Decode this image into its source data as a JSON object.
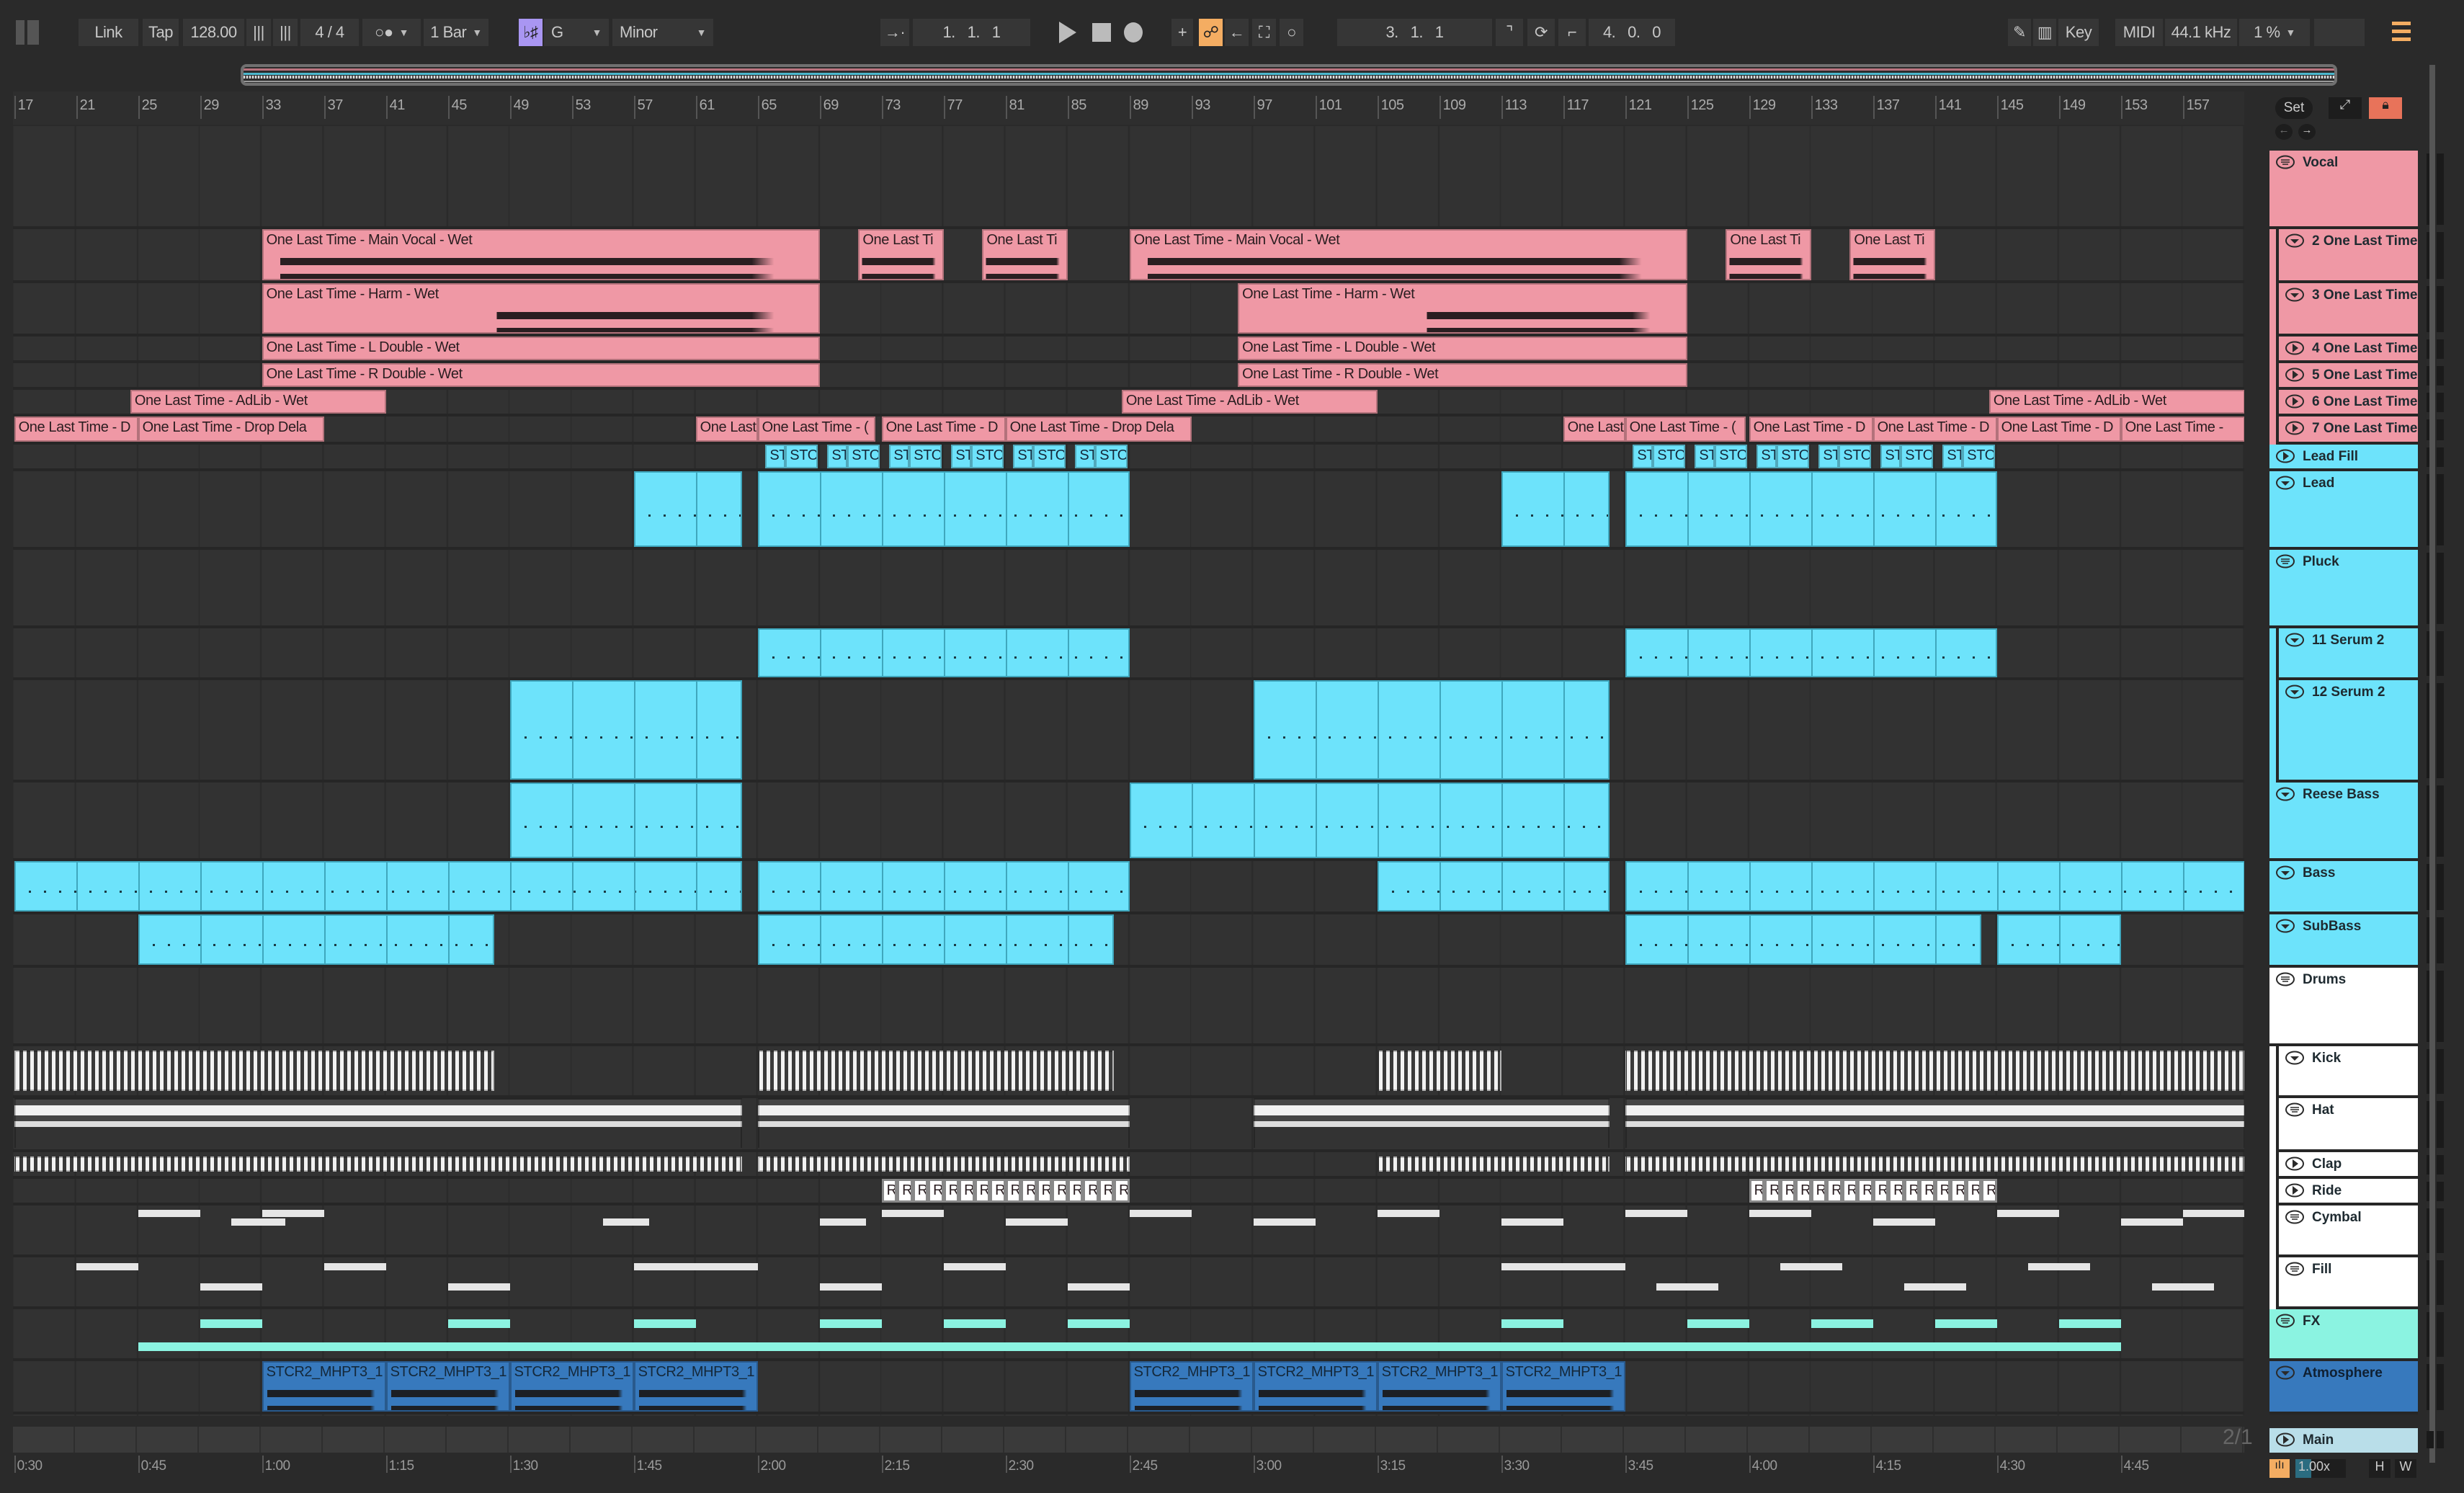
{
  "toolbar": {
    "link": "Link",
    "tap": "Tap",
    "tempo": "128.00",
    "time_signature": "4 / 4",
    "quantize": "1 Bar",
    "scale_toggle": "♭♯",
    "key_root": "G",
    "scale_mode": "Minor",
    "position": "1.   1.   1",
    "loop_start": "3.   1.   1",
    "loop_length": "4.   0.   0",
    "key_map": "Key",
    "midi_map": "MIDI",
    "sample_rate": "44.1 kHz",
    "cpu": "1 %",
    "accent": "#f4ad62",
    "scale_color": "#a996f2"
  },
  "ruler": {
    "bars": [
      17,
      21,
      25,
      29,
      33,
      37,
      41,
      45,
      49,
      53,
      57,
      61,
      65,
      69,
      73,
      77,
      81,
      85,
      89,
      93,
      97,
      101,
      105,
      109,
      113,
      117,
      121,
      125,
      129,
      133,
      137,
      141,
      145,
      149,
      153,
      157
    ],
    "set_button": "Set"
  },
  "timeline": {
    "labels": [
      "0:30",
      "0:45",
      "1:00",
      "1:15",
      "1:30",
      "1:45",
      "2:00",
      "2:15",
      "2:30",
      "2:45",
      "3:00",
      "3:15",
      "3:30",
      "3:45",
      "4:00",
      "4:15",
      "4:30",
      "4:45"
    ]
  },
  "colors": {
    "vocal": "#ef98a5",
    "synth": "#6de3fb",
    "drums": "#ffffff",
    "fx": "#8bf3e1",
    "atmo": "#3779bd",
    "main": "#b9dee9"
  },
  "tracks": [
    {
      "name": "Vocal",
      "icon": "group",
      "color": "vocal",
      "kind": "grp",
      "clips": []
    },
    {
      "name": "2 One Last Time",
      "icon": "expanded",
      "color": "vocal",
      "kind": "audio",
      "child": true,
      "clips": [
        {
          "name": "One Last Time - Main Vocal - Wet",
          "start": 33,
          "end": 69
        },
        {
          "name": "One Last Ti",
          "start": 71.5,
          "end": 77
        },
        {
          "name": "One Last Ti",
          "start": 79.5,
          "end": 85
        },
        {
          "name": "One Last Time - Main Vocal - Wet",
          "start": 89,
          "end": 125
        },
        {
          "name": "One Last Ti",
          "start": 127.5,
          "end": 133
        },
        {
          "name": "One Last Ti",
          "start": 135.5,
          "end": 141
        }
      ]
    },
    {
      "name": "3 One Last Time",
      "icon": "expanded",
      "color": "vocal",
      "kind": "audio",
      "child": true,
      "clips": [
        {
          "name": "One Last Time - Harm - Wet",
          "start": 33,
          "end": 69
        },
        {
          "name": "One Last Time - Harm - Wet",
          "start": 96,
          "end": 125
        }
      ]
    },
    {
      "name": "4 One Last Time",
      "icon": "collapsed",
      "color": "vocal",
      "kind": "label",
      "child": true,
      "clips": [
        {
          "name": "One Last Time - L Double - Wet",
          "start": 33,
          "end": 69
        },
        {
          "name": "One Last Time - L Double - Wet",
          "start": 96,
          "end": 125
        }
      ]
    },
    {
      "name": "5 One Last Time",
      "icon": "collapsed",
      "color": "vocal",
      "kind": "label",
      "child": true,
      "clips": [
        {
          "name": "One Last Time - R Double - Wet",
          "start": 33,
          "end": 69
        },
        {
          "name": "One Last Time - R Double - Wet",
          "start": 96,
          "end": 125
        }
      ]
    },
    {
      "name": "6 One Last Time",
      "icon": "collapsed",
      "color": "vocal",
      "kind": "label",
      "child": true,
      "clips": [
        {
          "name": "One Last Time - AdLib - Wet",
          "start": 24.5,
          "end": 41
        },
        {
          "name": "One Last Time - AdLib - Wet",
          "start": 88.5,
          "end": 105
        },
        {
          "name": "One Last Time - AdLib - Wet",
          "start": 144.5,
          "end": 161
        }
      ]
    },
    {
      "name": "7 One Last Time",
      "icon": "collapsed",
      "color": "vocal",
      "kind": "label",
      "child": true,
      "clips": [
        {
          "name": "One Last Time - D",
          "start": 17,
          "end": 25
        },
        {
          "name": "One Last Time - Drop Dela",
          "start": 25,
          "end": 37
        },
        {
          "name": "One Last",
          "start": 61,
          "end": 65
        },
        {
          "name": "One Last Time - (",
          "start": 65,
          "end": 72.6
        },
        {
          "name": "One Last Time - D",
          "start": 73,
          "end": 81
        },
        {
          "name": "One Last Time - Drop Dela",
          "start": 81,
          "end": 93
        },
        {
          "name": "One Last",
          "start": 117,
          "end": 121
        },
        {
          "name": "One Last Time - (",
          "start": 121,
          "end": 128.8
        },
        {
          "name": "One Last Time - D",
          "start": 129,
          "end": 137
        },
        {
          "name": "One Last Time - D",
          "start": 137,
          "end": 145
        },
        {
          "name": "One Last Time - D",
          "start": 145,
          "end": 153
        },
        {
          "name": "One Last Time -",
          "start": 153,
          "end": 161
        }
      ]
    },
    {
      "name": "Lead Fill",
      "icon": "collapsed",
      "color": "synth",
      "kind": "label",
      "clips": [
        {
          "name": "ST",
          "start": 65.5,
          "end": 66.8
        },
        {
          "name": "STO",
          "start": 66.8,
          "end": 68.9
        },
        {
          "name": "ST",
          "start": 69.5,
          "end": 70.8
        },
        {
          "name": "STO",
          "start": 70.8,
          "end": 72.9
        },
        {
          "name": "ST",
          "start": 73.5,
          "end": 74.8
        },
        {
          "name": "STO",
          "start": 74.8,
          "end": 76.9
        },
        {
          "name": "ST",
          "start": 77.5,
          "end": 78.8
        },
        {
          "name": "STO",
          "start": 78.8,
          "end": 80.9
        },
        {
          "name": "ST",
          "start": 81.5,
          "end": 82.8
        },
        {
          "name": "STO",
          "start": 82.8,
          "end": 84.9
        },
        {
          "name": "ST",
          "start": 85.5,
          "end": 86.8
        },
        {
          "name": "STO",
          "start": 86.8,
          "end": 88.9
        },
        {
          "name": "ST",
          "start": 121.5,
          "end": 122.8
        },
        {
          "name": "STO",
          "start": 122.8,
          "end": 124.9
        },
        {
          "name": "ST",
          "start": 125.5,
          "end": 126.8
        },
        {
          "name": "STO",
          "start": 126.8,
          "end": 128.9
        },
        {
          "name": "ST",
          "start": 129.5,
          "end": 130.8
        },
        {
          "name": "STO",
          "start": 130.8,
          "end": 132.9
        },
        {
          "name": "ST",
          "start": 133.5,
          "end": 134.8
        },
        {
          "name": "STO",
          "start": 134.8,
          "end": 136.9
        },
        {
          "name": "ST",
          "start": 137.5,
          "end": 138.8
        },
        {
          "name": "STO",
          "start": 138.8,
          "end": 140.9
        },
        {
          "name": "ST",
          "start": 141.5,
          "end": 142.8
        },
        {
          "name": "STO",
          "start": 142.8,
          "end": 144.9
        }
      ]
    },
    {
      "name": "Lead",
      "icon": "expanded",
      "color": "synth",
      "kind": "midi",
      "clips": [
        {
          "start": 57,
          "end": 64
        },
        {
          "start": 65,
          "end": 89
        },
        {
          "start": 113,
          "end": 120
        },
        {
          "start": 121,
          "end": 145
        }
      ]
    },
    {
      "name": "Pluck",
      "icon": "group",
      "color": "synth",
      "kind": "grp",
      "clips": []
    },
    {
      "name": "11 Serum 2",
      "icon": "expanded",
      "color": "synth",
      "kind": "midi",
      "child": true,
      "clips": [
        {
          "start": 65,
          "end": 89
        },
        {
          "start": 121,
          "end": 145
        }
      ]
    },
    {
      "name": "12 Serum 2",
      "icon": "expanded",
      "color": "synth",
      "kind": "midi",
      "child": true,
      "clips": [
        {
          "start": 49,
          "end": 64
        },
        {
          "start": 97,
          "end": 120
        }
      ]
    },
    {
      "name": "Reese Bass",
      "icon": "expanded",
      "color": "synth",
      "kind": "midi",
      "clips": [
        {
          "start": 49,
          "end": 64
        },
        {
          "start": 89,
          "end": 120
        }
      ]
    },
    {
      "name": "Bass",
      "icon": "expanded",
      "color": "synth",
      "kind": "midi",
      "clips": [
        {
          "start": 17,
          "end": 64
        },
        {
          "start": 65,
          "end": 89
        },
        {
          "start": 105,
          "end": 120
        },
        {
          "start": 121,
          "end": 161
        }
      ]
    },
    {
      "name": "SubBass",
      "icon": "expanded",
      "color": "synth",
      "kind": "midi",
      "clips": [
        {
          "start": 25,
          "end": 48
        },
        {
          "start": 65,
          "end": 88
        },
        {
          "start": 121,
          "end": 144
        },
        {
          "start": 145,
          "end": 153
        }
      ]
    },
    {
      "name": "Drums",
      "icon": "group",
      "color": "drums",
      "kind": "grp",
      "clips": []
    },
    {
      "name": "Kick",
      "icon": "expanded",
      "color": "drums",
      "kind": "stripe",
      "child": true,
      "clips": [
        {
          "start": 17,
          "end": 48
        },
        {
          "start": 65,
          "end": 88
        },
        {
          "start": 105,
          "end": 113
        },
        {
          "start": 121,
          "end": 161
        }
      ]
    },
    {
      "name": "Hat",
      "icon": "group",
      "color": "drums",
      "kind": "band",
      "child": true,
      "clips": [
        {
          "start": 17,
          "end": 64
        },
        {
          "start": 65,
          "end": 89
        },
        {
          "start": 97,
          "end": 120
        },
        {
          "start": 121,
          "end": 161
        }
      ]
    },
    {
      "name": "Clap",
      "icon": "collapsed",
      "color": "drums",
      "kind": "stripe",
      "child": true,
      "clips": [
        {
          "start": 17,
          "end": 64
        },
        {
          "start": 65,
          "end": 89
        },
        {
          "start": 105,
          "end": 120
        },
        {
          "start": 121,
          "end": 161
        }
      ]
    },
    {
      "name": "Ride",
      "icon": "collapsed",
      "color": "drums",
      "kind": "label",
      "child": true,
      "clips": [
        {
          "name": "R",
          "start": 73,
          "end": 74
        },
        {
          "name": "Ri",
          "start": 74,
          "end": 75
        },
        {
          "name": "Ri",
          "start": 75,
          "end": 76
        },
        {
          "name": "R",
          "start": 76,
          "end": 77
        },
        {
          "name": "Ri",
          "start": 77,
          "end": 78
        },
        {
          "name": "Ri",
          "start": 78,
          "end": 79
        },
        {
          "name": "Ri",
          "start": 79,
          "end": 80
        },
        {
          "name": "R",
          "start": 80,
          "end": 81
        },
        {
          "name": "Ri",
          "start": 81,
          "end": 82
        },
        {
          "name": "Ri",
          "start": 82,
          "end": 83
        },
        {
          "name": "Ri",
          "start": 83,
          "end": 84
        },
        {
          "name": "R",
          "start": 84,
          "end": 85
        },
        {
          "name": "Ri",
          "start": 85,
          "end": 86
        },
        {
          "name": "Ri",
          "start": 86,
          "end": 87
        },
        {
          "name": "R",
          "start": 87,
          "end": 88
        },
        {
          "name": "Ri",
          "start": 88,
          "end": 89
        },
        {
          "name": "R",
          "start": 129,
          "end": 130
        },
        {
          "name": "Ri",
          "start": 130,
          "end": 131
        },
        {
          "name": "Ri",
          "start": 131,
          "end": 132
        },
        {
          "name": "R",
          "start": 132,
          "end": 133
        },
        {
          "name": "Ri",
          "start": 133,
          "end": 134
        },
        {
          "name": "Ri",
          "start": 134,
          "end": 135
        },
        {
          "name": "Ri",
          "start": 135,
          "end": 136
        },
        {
          "name": "R",
          "start": 136,
          "end": 137
        },
        {
          "name": "Ri",
          "start": 137,
          "end": 138
        },
        {
          "name": "Ri",
          "start": 138,
          "end": 139
        },
        {
          "name": "Ri",
          "start": 139,
          "end": 140
        },
        {
          "name": "R",
          "start": 140,
          "end": 141
        },
        {
          "name": "Ri",
          "start": 141,
          "end": 142
        },
        {
          "name": "Ri",
          "start": 142,
          "end": 143
        },
        {
          "name": "R",
          "start": 143,
          "end": 144
        },
        {
          "name": "Ri",
          "start": 144,
          "end": 145
        }
      ]
    },
    {
      "name": "Cymbal",
      "icon": "group",
      "color": "drums",
      "kind": "short",
      "child": true,
      "clips": [
        {
          "start": 25,
          "end": 29
        },
        {
          "start": 31,
          "end": 34.5
        },
        {
          "start": 33,
          "end": 37
        },
        {
          "start": 55,
          "end": 58
        },
        {
          "start": 73,
          "end": 77
        },
        {
          "start": 69,
          "end": 72
        },
        {
          "start": 89,
          "end": 93
        },
        {
          "start": 81,
          "end": 85
        },
        {
          "start": 105,
          "end": 109
        },
        {
          "start": 97,
          "end": 101
        },
        {
          "start": 121,
          "end": 125
        },
        {
          "start": 113,
          "end": 117
        },
        {
          "start": 129,
          "end": 133
        },
        {
          "start": 137,
          "end": 141
        },
        {
          "start": 145,
          "end": 149
        },
        {
          "start": 153,
          "end": 157
        },
        {
          "start": 157,
          "end": 161
        }
      ]
    },
    {
      "name": "Fill",
      "icon": "group",
      "color": "drums",
      "kind": "short",
      "child": true,
      "clips": [
        {
          "start": 21,
          "end": 25
        },
        {
          "start": 29,
          "end": 33
        },
        {
          "start": 37,
          "end": 41
        },
        {
          "start": 45,
          "end": 49
        },
        {
          "start": 57,
          "end": 65
        },
        {
          "start": 69,
          "end": 73
        },
        {
          "start": 77,
          "end": 81
        },
        {
          "start": 85,
          "end": 89
        },
        {
          "start": 113,
          "end": 121
        },
        {
          "start": 123,
          "end": 127
        },
        {
          "start": 131,
          "end": 135
        },
        {
          "start": 139,
          "end": 143
        },
        {
          "start": 147,
          "end": 151
        },
        {
          "start": 155,
          "end": 159
        }
      ]
    },
    {
      "name": "FX",
      "icon": "group",
      "color": "fx",
      "kind": "fx",
      "clips": [
        {
          "start": 29,
          "end": 33
        },
        {
          "start": 45,
          "end": 49
        },
        {
          "start": 57,
          "end": 61
        },
        {
          "start": 69,
          "end": 73
        },
        {
          "start": 77,
          "end": 81
        },
        {
          "start": 85,
          "end": 89
        },
        {
          "start": 113,
          "end": 117
        },
        {
          "start": 125,
          "end": 129
        },
        {
          "start": 133,
          "end": 137
        },
        {
          "start": 141,
          "end": 145
        },
        {
          "start": 149,
          "end": 153
        }
      ]
    },
    {
      "name": "Atmosphere",
      "icon": "expanded",
      "color": "atmo",
      "kind": "audio",
      "clips": [
        {
          "name": "STCR2_MHPT3_1",
          "start": 33,
          "end": 41
        },
        {
          "name": "STCR2_MHPT3_1",
          "start": 41,
          "end": 49
        },
        {
          "name": "STCR2_MHPT3_1",
          "start": 49,
          "end": 57
        },
        {
          "name": "STCR2_MHPT3_1",
          "start": 57,
          "end": 65
        },
        {
          "name": "STCR2_MHPT3_1",
          "start": 89,
          "end": 97
        },
        {
          "name": "STCR2_MHPT3_1",
          "start": 97,
          "end": 105
        },
        {
          "name": "STCR2_MHPT3_1",
          "start": 105,
          "end": 113
        },
        {
          "name": "STCR2_MHPT3_1",
          "start": 113,
          "end": 121
        }
      ]
    }
  ],
  "main_track": {
    "name": "Main",
    "icon": "collapsed",
    "time_sig_display": "2/1"
  },
  "footer": {
    "zoom": "1.00x",
    "h_button": "H",
    "w_button": "W"
  }
}
